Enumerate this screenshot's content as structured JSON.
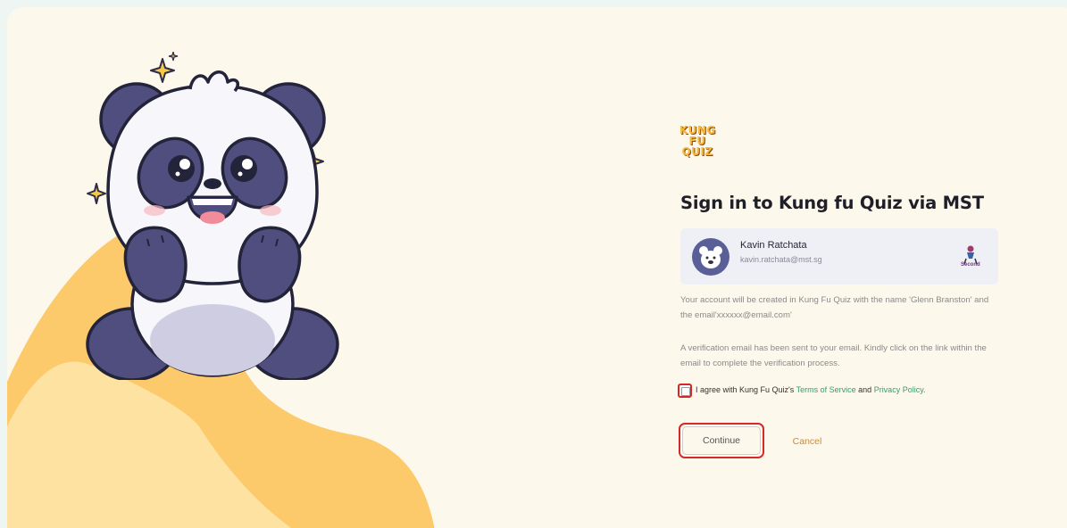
{
  "logo": {
    "line1": "KUNG",
    "line2": "FU",
    "line3": "QUIZ"
  },
  "title": "Sign in to Kung fu Quiz via MST",
  "account": {
    "name": "Kavin Ratchata",
    "email": "kavin.ratchata@mst.sg",
    "app_badge": "Second"
  },
  "info": {
    "line1": "Your account will be created in Kung Fu Quiz with the name 'Glenn Branston' and the email'xxxxxx@email.com'",
    "line2": "A verification email has been sent to your email. Kindly click on the link within the email to complete the verification process."
  },
  "agree": {
    "prefix": "I agree with Kung Fu Quiz's ",
    "terms": "Terms of Service",
    "and": " and ",
    "privacy": "Privacy Policy."
  },
  "buttons": {
    "continue": "Continue",
    "cancel": "Cancel"
  },
  "colors": {
    "background": "#fdf8ec",
    "accent_yellow": "#fcc96b",
    "panda_dark": "#4f4e7e",
    "link_green": "#2f9e74",
    "highlight_red": "#d42a2a",
    "cancel_orange": "#d18a2a"
  }
}
